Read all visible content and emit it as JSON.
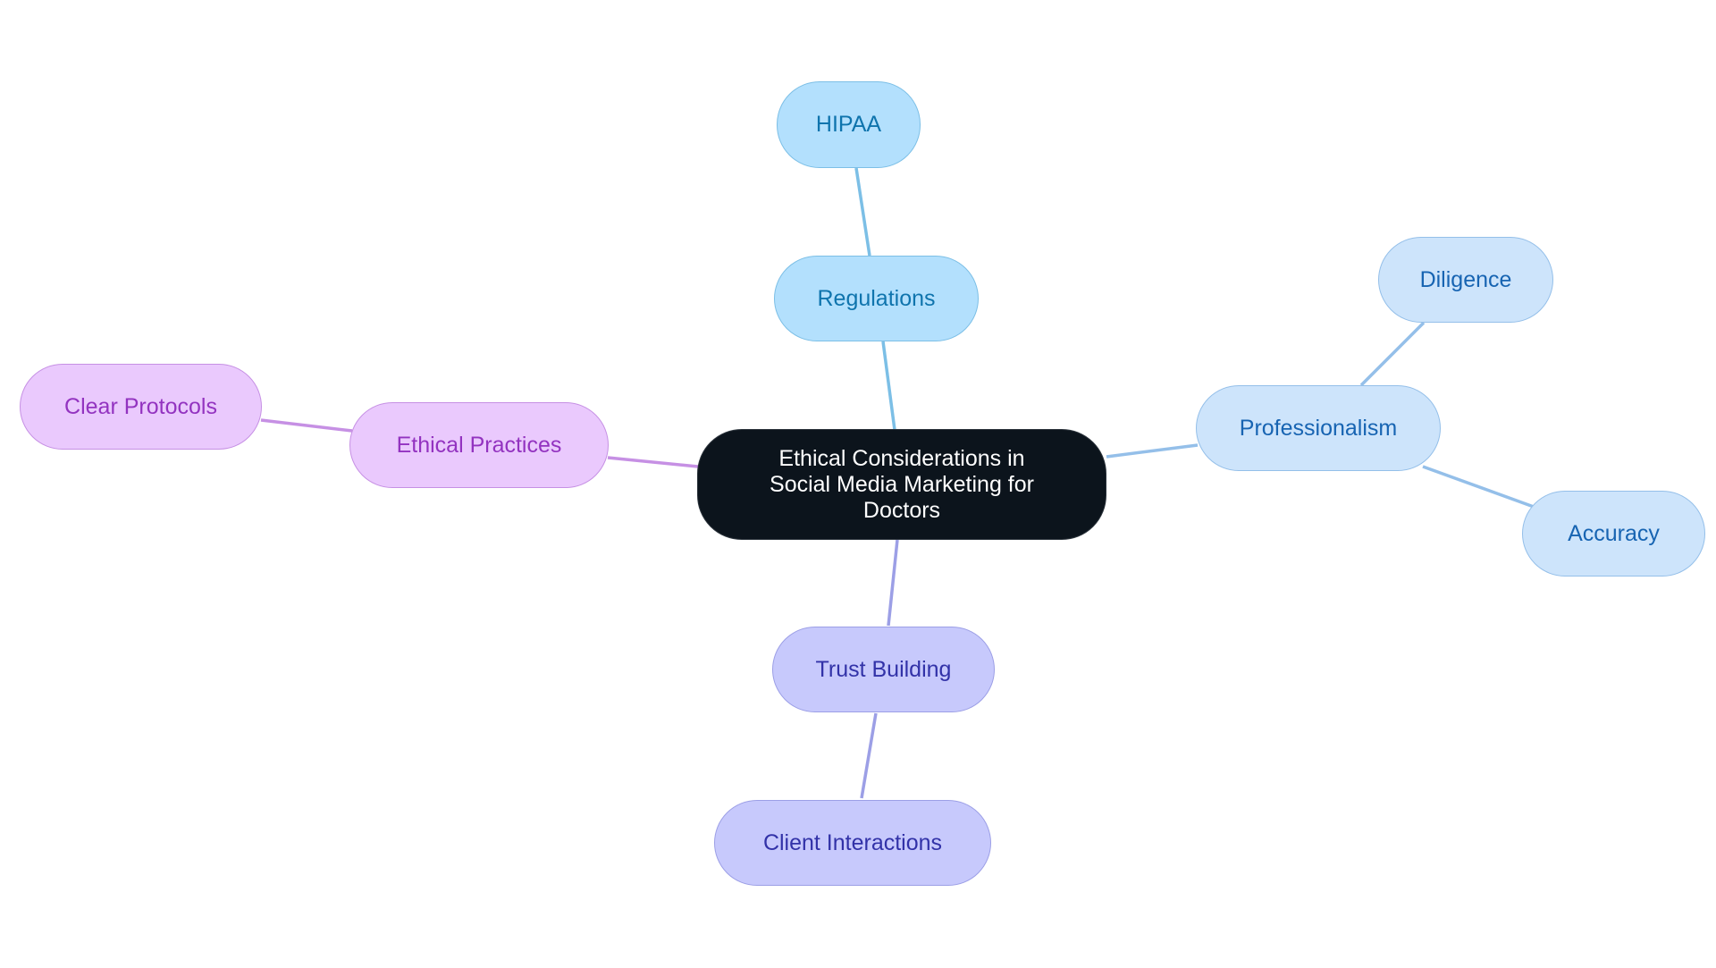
{
  "diagram": {
    "type": "mindmap",
    "root": {
      "id": "root",
      "label": "Ethical Considerations in Social Media Marketing for Doctors"
    },
    "branches": [
      {
        "id": "regulations",
        "label": "Regulations",
        "color": "#7cbfe6",
        "children": [
          {
            "id": "hipaa",
            "label": "HIPAA"
          }
        ]
      },
      {
        "id": "professionalism",
        "label": "Professionalism",
        "color": "#94bfe9",
        "children": [
          {
            "id": "diligence",
            "label": "Diligence"
          },
          {
            "id": "accuracy",
            "label": "Accuracy"
          }
        ]
      },
      {
        "id": "trust-building",
        "label": "Trust Building",
        "color": "#9c9fe6",
        "children": [
          {
            "id": "client-interactions",
            "label": "Client Interactions"
          }
        ]
      },
      {
        "id": "ethical-practices",
        "label": "Ethical Practices",
        "color": "#c690e4",
        "children": [
          {
            "id": "clear-protocols",
            "label": "Clear Protocols"
          }
        ]
      }
    ]
  }
}
